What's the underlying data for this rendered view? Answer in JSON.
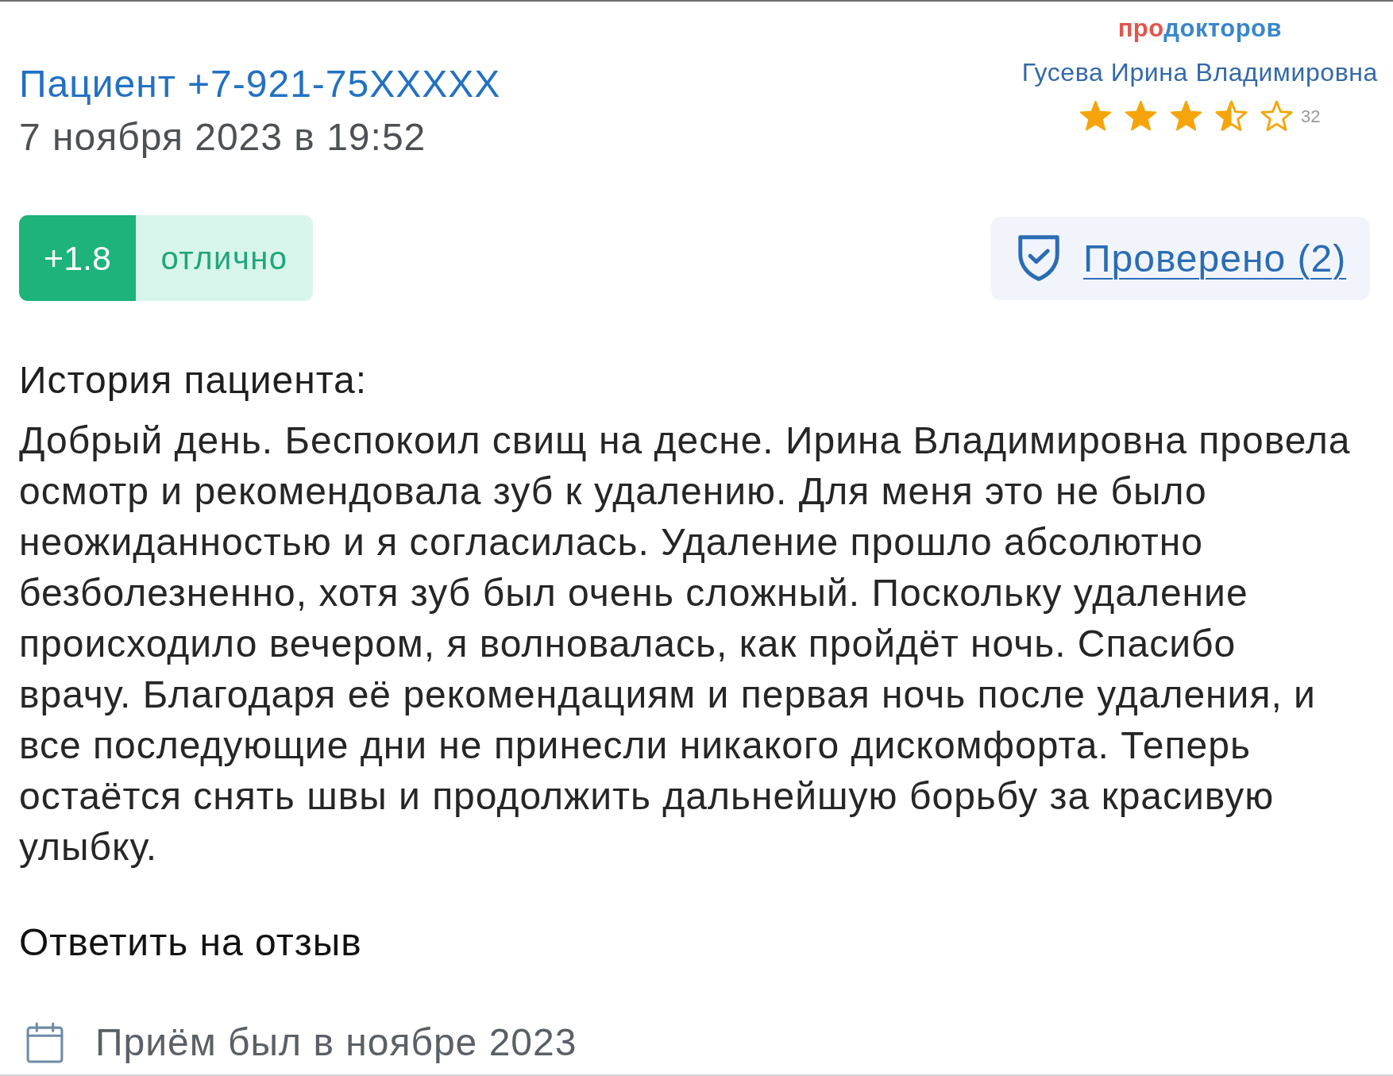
{
  "review": {
    "author": "Пациент +7-921-75XXXXX",
    "date": "7 ноября 2023 в 19:52"
  },
  "doctor": {
    "logo": [
      {
        "text": "про",
        "color": "#e2554f"
      },
      {
        "text": "докторов",
        "color": "#3a86cc"
      }
    ],
    "name": "Гусева Ирина Владимировна",
    "stars": 3.5,
    "review_count": "32"
  },
  "score": {
    "value": "+1.8",
    "label": "отлично"
  },
  "verified": {
    "label": "Проверено (2)"
  },
  "story": {
    "heading": "История пациента:",
    "text": "Добрый день. Беспокоил свищ на десне. Ирина Владимировна провела осмотр и рекомендовала зуб к удалению. Для меня это не было неожиданностью и я согласилась. Удаление прошло абсолютно безболезненно, хотя зуб был очень сложный. Поскольку удаление происходило вечером, я волновалась, как пройдёт ночь. Спасибо врачу. Благодаря её рекомендациям и первая ночь после удаления, и все последующие дни не принесли никакого дискомфорта. Теперь остаётся снять швы и продолжить дальнейшую борьбу за красивую улыбку."
  },
  "reply_link": "Ответить на отзыв",
  "visit": {
    "text": "Приём был в ноябре 2023"
  }
}
